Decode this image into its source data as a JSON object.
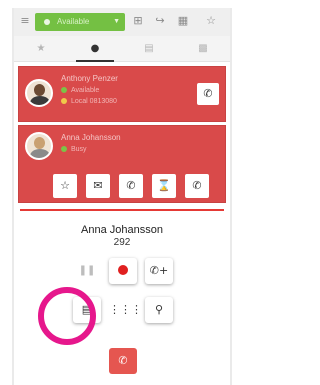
{
  "toolbar": {
    "presence": {
      "label": "Available",
      "color": "#74c043"
    },
    "icons": [
      "menu-icon",
      "grid-icon",
      "call-forward-icon",
      "calendar-icon",
      "star-icon"
    ]
  },
  "tabs": [
    {
      "icon": "star-icon",
      "active": false
    },
    {
      "icon": "person-icon",
      "active": true
    },
    {
      "icon": "book-icon",
      "active": false
    },
    {
      "icon": "voicemail-icon",
      "active": false
    }
  ],
  "contacts": [
    {
      "name": "Anthony Penzer",
      "lines": [
        "Available",
        "Local 0813080"
      ],
      "status_color": "#7cc347"
    },
    {
      "name": "Anna Johansson",
      "lines": [
        "Busy"
      ],
      "status_color": "#7cc347",
      "actions": [
        "star-icon",
        "chat-icon",
        "phone-icon",
        "hourglass-icon",
        "phone-icon"
      ]
    }
  ],
  "call": {
    "name": "Anna Johansson",
    "extension": "292",
    "accent": "#e53935",
    "highlight": "#e6178c"
  }
}
